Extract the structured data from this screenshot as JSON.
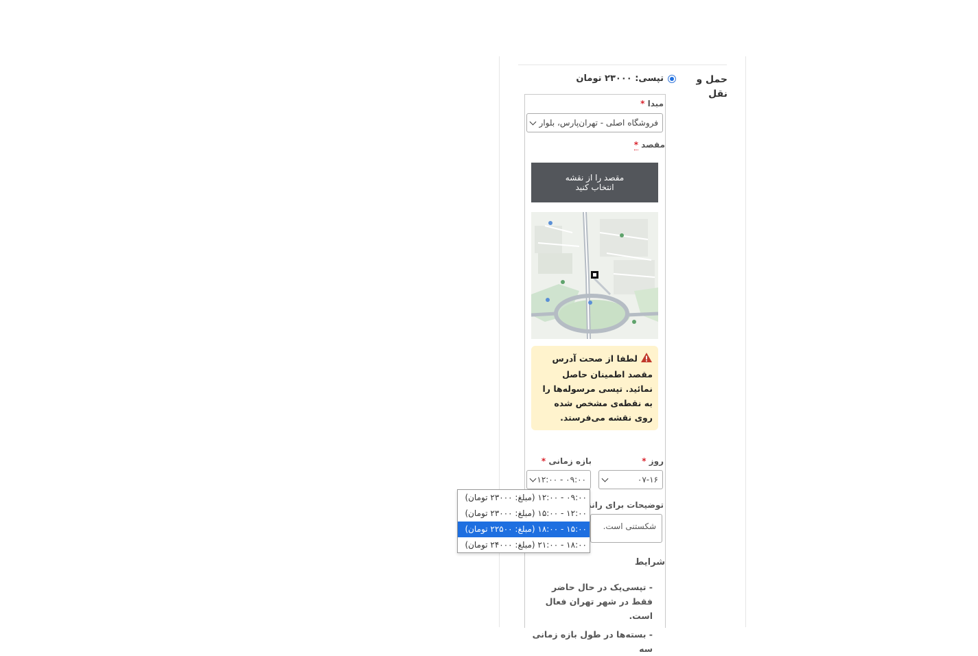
{
  "shipping": {
    "section_label": "حمل و نقل",
    "option_label": "تپسی: ۲۳۰۰۰ تومان"
  },
  "origin": {
    "label": "مبدا",
    "required_mark": "*",
    "selected": "فروشگاه اصلی - تهران‌پارس، بلوار"
  },
  "destination": {
    "label": "مقصد",
    "required_mark": "*",
    "map_button_line1": "مقصد را از نقشه",
    "map_button_line2": "انتخاب کنید"
  },
  "alert": {
    "text": "لطفا از صحت آدرس مقصد اطمینان حاصل نمائید. تپسی مرسوله‌ها را به نقطه‌ی مشخص شده روی نقشه می‌فرستد."
  },
  "day": {
    "label": "روز",
    "required_mark": "*",
    "selected": "۰۷-۱۶"
  },
  "time_range": {
    "label": "بازه زمانی",
    "required_mark": "*",
    "selected": "۰۹:۰۰ - ۱۲:۰۰",
    "options": [
      "۰۹:۰۰ - ۱۲:۰۰ (مبلغ: ۲۳۰۰۰ تومان)",
      "۱۲:۰۰ - ۱۵:۰۰ (مبلغ: ۲۳۰۰۰ تومان)",
      "۱۵:۰۰ - ۱۸:۰۰ (مبلغ: ۲۲۵۰۰ تومان)",
      "۱۸:۰۰ - ۲۱:۰۰ (مبلغ: ۲۴۰۰۰ تومان)"
    ],
    "highlighted_index": 2
  },
  "driver_notes": {
    "label": "توضیحات برای راننده",
    "value": "شکستنی است."
  },
  "terms": {
    "title": "شرایط",
    "line1": "- تپسی‌پک در حال حاضر فقط در شهر تهران فعال است.",
    "line2": "- بسته‌ها در طول بازه زمانی سه"
  },
  "colors": {
    "accent": "#1e6fe0",
    "map_button": "#53565b",
    "alert_bg": "#fff3cd",
    "required": "#d9232d",
    "warning_icon": "#c0392b"
  }
}
